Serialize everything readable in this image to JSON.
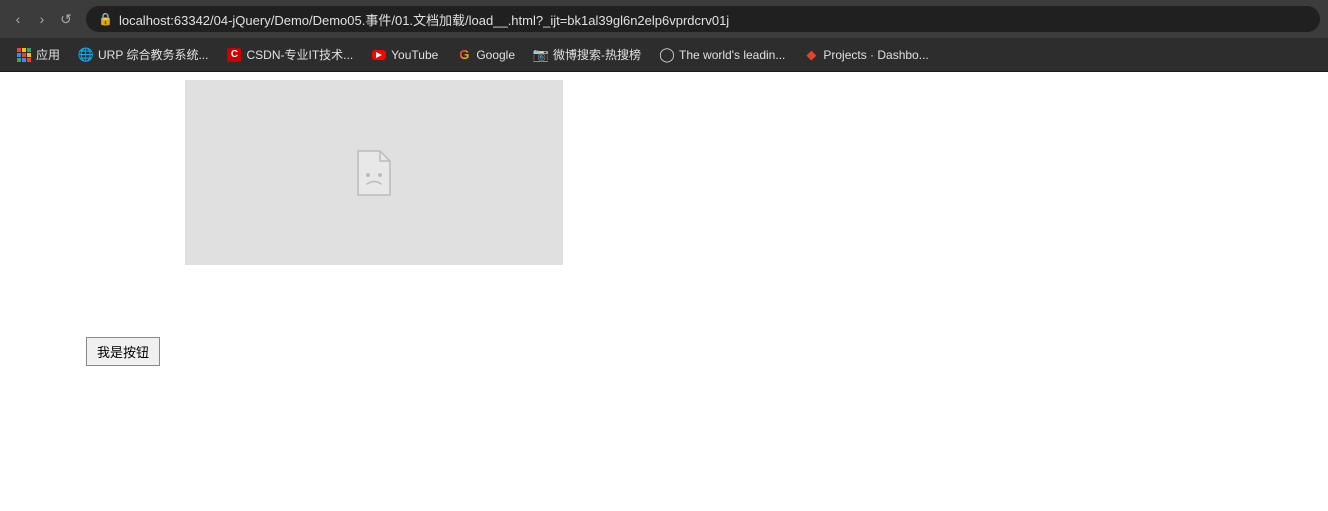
{
  "browser": {
    "nav": {
      "back_btn": "‹",
      "forward_btn": "›",
      "reload_btn": "↺",
      "address": "localhost:63342/04-jQuery/Demo/Demo05.事件/01.文档加载/load__.html?_ijt=bk1al39gl6n2elp6vprdcrv01j"
    },
    "bookmarks": [
      {
        "id": "apps",
        "label": "应用",
        "type": "apps"
      },
      {
        "id": "urp",
        "label": "URP 综合教务系统...",
        "type": "globe"
      },
      {
        "id": "csdn",
        "label": "CSDN-专业IT技术...",
        "type": "csdn"
      },
      {
        "id": "youtube",
        "label": "YouTube",
        "type": "youtube"
      },
      {
        "id": "google",
        "label": "Google",
        "type": "google"
      },
      {
        "id": "weibo",
        "label": "微博搜索-热搜榜",
        "type": "weibo"
      },
      {
        "id": "github",
        "label": "The world's leadin...",
        "type": "github"
      },
      {
        "id": "gitlab",
        "label": "Projects · Dashbo...",
        "type": "gitlab"
      }
    ]
  },
  "page": {
    "button_label": "我是按钮"
  }
}
